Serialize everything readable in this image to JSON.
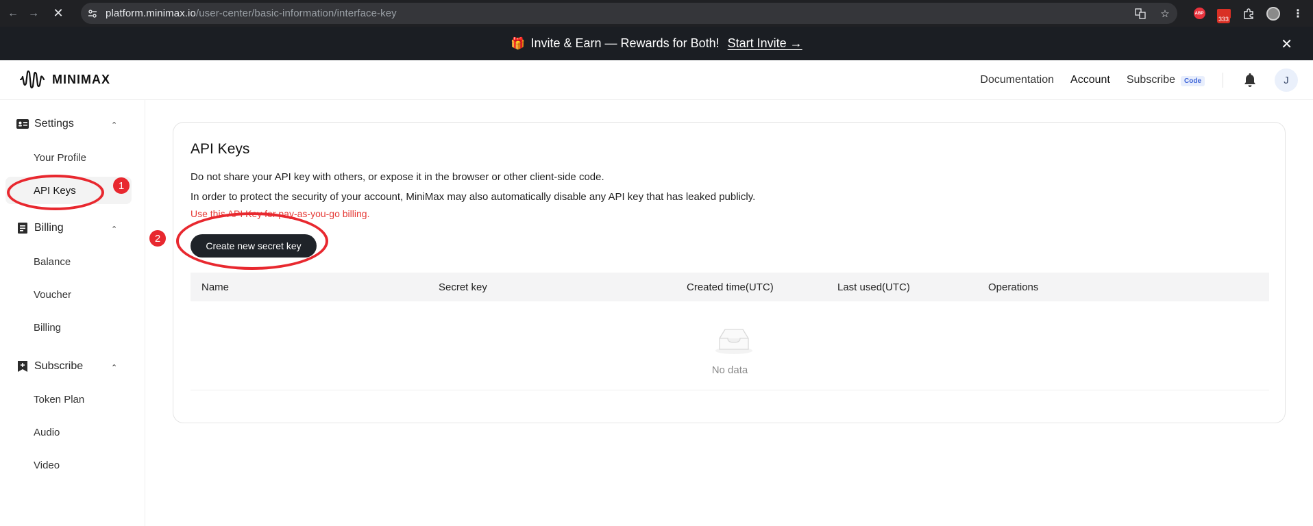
{
  "browser": {
    "url_domain": "platform.minimax.io",
    "url_path": "/user-center/basic-information/interface-key",
    "extension_badge": "333"
  },
  "promo": {
    "text": "Invite & Earn — Rewards for Both!",
    "link": "Start Invite →",
    "close": "✕"
  },
  "header": {
    "brand": "MINIMAX",
    "nav": {
      "documentation": "Documentation",
      "account": "Account",
      "subscribe": "Subscribe",
      "code_badge": "Code"
    },
    "avatar_initial": "J"
  },
  "sidebar": {
    "settings": {
      "title": "Settings",
      "items": [
        "Your Profile",
        "API Keys"
      ]
    },
    "billing": {
      "title": "Billing",
      "items": [
        "Balance",
        "Voucher",
        "Billing"
      ]
    },
    "subscribe": {
      "title": "Subscribe",
      "items": [
        "Token Plan",
        "Audio",
        "Video"
      ]
    },
    "active_item": "API Keys"
  },
  "annotations": [
    "1",
    "2"
  ],
  "main": {
    "title": "API Keys",
    "line1": "Do not share your API key with others, or expose it in the browser or other client-side code.",
    "line2": "In order to protect the security of your account, MiniMax may also automatically disable any API key that has leaked publicly.",
    "warning": "Use this API Key for pay-as-you-go billing.",
    "create_button": "Create new secret key",
    "table": {
      "columns": [
        "Name",
        "Secret key",
        "Created time(UTC)",
        "Last used(UTC)",
        "Operations"
      ],
      "empty_text": "No data"
    }
  },
  "colors": {
    "accent_red": "#e8282f",
    "button_dark": "#1f2329",
    "promo_bg": "#1b1e23"
  }
}
